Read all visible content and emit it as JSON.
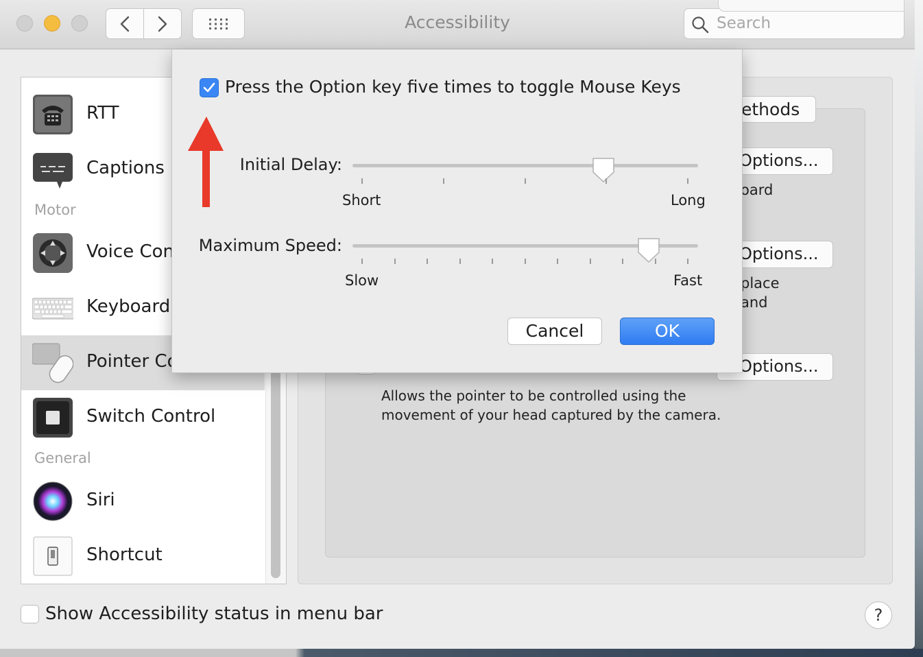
{
  "window": {
    "title": "Accessibility"
  },
  "search": {
    "placeholder": "Search"
  },
  "sidebar": {
    "items": [
      {
        "label": "RTT",
        "icon": "phone-icon"
      },
      {
        "label": "Captions",
        "icon": "captions-icon"
      },
      {
        "section": "Motor"
      },
      {
        "label": "Voice Con",
        "icon": "voice-control-icon"
      },
      {
        "label": "Keyboard",
        "icon": "keyboard-icon"
      },
      {
        "label": "Pointer Co",
        "icon": "pointer-control-icon",
        "selected": true
      },
      {
        "label": "Switch Control",
        "icon": "switch-control-icon"
      },
      {
        "section": "General"
      },
      {
        "label": "Siri",
        "icon": "siri-icon"
      },
      {
        "label": "Shortcut",
        "icon": "shortcut-icon"
      }
    ]
  },
  "background_panel": {
    "tab_fragment": "ethods",
    "options_buttons": [
      "Options...",
      "Options...",
      "Options..."
    ],
    "fragments": [
      "oard",
      "place",
      "and"
    ],
    "description_line1": "Allows the pointer to be controlled using the",
    "description_line2": "movement of your head captured by the camera."
  },
  "sheet": {
    "checkbox_label": "Press the Option key five times to toggle Mouse Keys",
    "checkbox_checked": true,
    "initial_delay": {
      "label": "Initial Delay:",
      "min_label": "Short",
      "max_label": "Long",
      "value_fraction": 0.74,
      "ticks": 5
    },
    "maximum_speed": {
      "label": "Maximum Speed:",
      "min_label": "Slow",
      "max_label": "Fast",
      "value_fraction": 0.88,
      "ticks": 11
    },
    "cancel_label": "Cancel",
    "ok_label": "OK"
  },
  "footer": {
    "status_checkbox_label": "Show Accessibility status in menu bar",
    "status_checked": false,
    "help_label": "?"
  },
  "colors": {
    "accent": "#3a86f5",
    "annotation_arrow": "#e8392a"
  }
}
